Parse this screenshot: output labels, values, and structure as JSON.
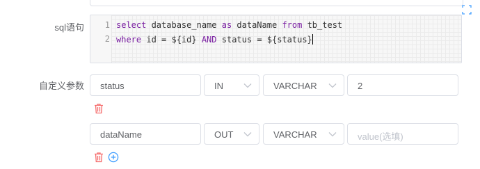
{
  "form": {
    "sql_label": "sql语句",
    "params_label": "自定义参数",
    "sql_lines": [
      {
        "no": "1",
        "segments": [
          {
            "t": "select",
            "kw": true
          },
          {
            "t": " database_name "
          },
          {
            "t": "as",
            "kw": true
          },
          {
            "t": " dataName "
          },
          {
            "t": "from",
            "kw": true
          },
          {
            "t": " tb_test"
          }
        ]
      },
      {
        "no": "2",
        "segments": [
          {
            "t": "where",
            "kw": true
          },
          {
            "t": " id = ${id} "
          },
          {
            "t": "AND",
            "kw": true
          },
          {
            "t": " status = ${status}"
          }
        ]
      }
    ]
  },
  "params": [
    {
      "name": "status",
      "direct": "IN",
      "type": "VARCHAR",
      "value": "2",
      "value_placeholder": "value(选填)"
    },
    {
      "name": "dataName",
      "direct": "OUT",
      "type": "VARCHAR",
      "value": "",
      "value_placeholder": "value(选填)"
    }
  ],
  "colors": {
    "delete": "#f56c6c",
    "add": "#409eff",
    "keyword": "#7a1fa2"
  },
  "icons": {
    "delete": "trash-icon",
    "add": "plus-circle-icon",
    "expand": "fullscreen-icon"
  }
}
